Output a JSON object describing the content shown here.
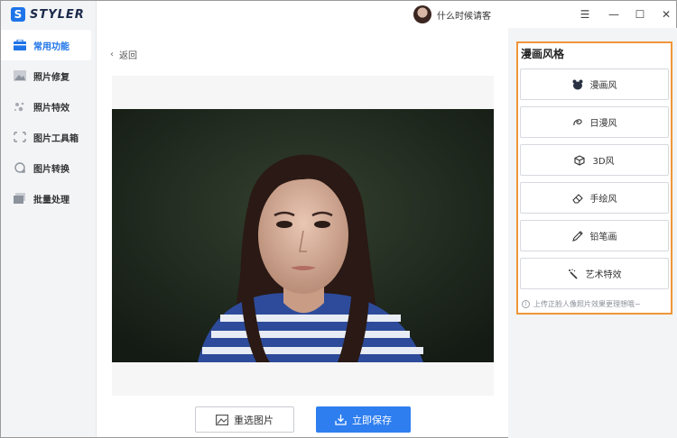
{
  "app": {
    "logo_letter": "S",
    "logo_text": "STYLER"
  },
  "user": {
    "name": "什么时候请客"
  },
  "window_controls": [
    "☰",
    "—",
    "☐",
    "✕"
  ],
  "sidebar": {
    "items": [
      {
        "label": "常用功能",
        "icon": "briefcase-icon",
        "active": true
      },
      {
        "label": "照片修复",
        "icon": "image-icon",
        "active": false
      },
      {
        "label": "照片特效",
        "icon": "sparkle-icon",
        "active": false
      },
      {
        "label": "图片工具箱",
        "icon": "crop-icon",
        "active": false
      },
      {
        "label": "图片转换",
        "icon": "convert-icon",
        "active": false
      },
      {
        "label": "批量处理",
        "icon": "batch-icon",
        "active": false
      }
    ]
  },
  "main": {
    "back_label": "返回"
  },
  "actions": {
    "reselect_label": "重选图片",
    "save_label": "立即保存"
  },
  "panel": {
    "title": "漫画风格",
    "styles": [
      {
        "label": "漫画风",
        "icon": "bear-icon"
      },
      {
        "label": "日漫风",
        "icon": "swirl-icon"
      },
      {
        "label": "3D风",
        "icon": "cube-icon"
      },
      {
        "label": "手绘风",
        "icon": "eraser-icon"
      },
      {
        "label": "铅笔画",
        "icon": "pencil-icon"
      },
      {
        "label": "艺术特效",
        "icon": "magic-wand-icon"
      }
    ],
    "hint": "上传正脸人像照片效果更理想哦~"
  },
  "colors": {
    "accent": "#2e7ef0",
    "highlight_border": "#f0963a"
  }
}
